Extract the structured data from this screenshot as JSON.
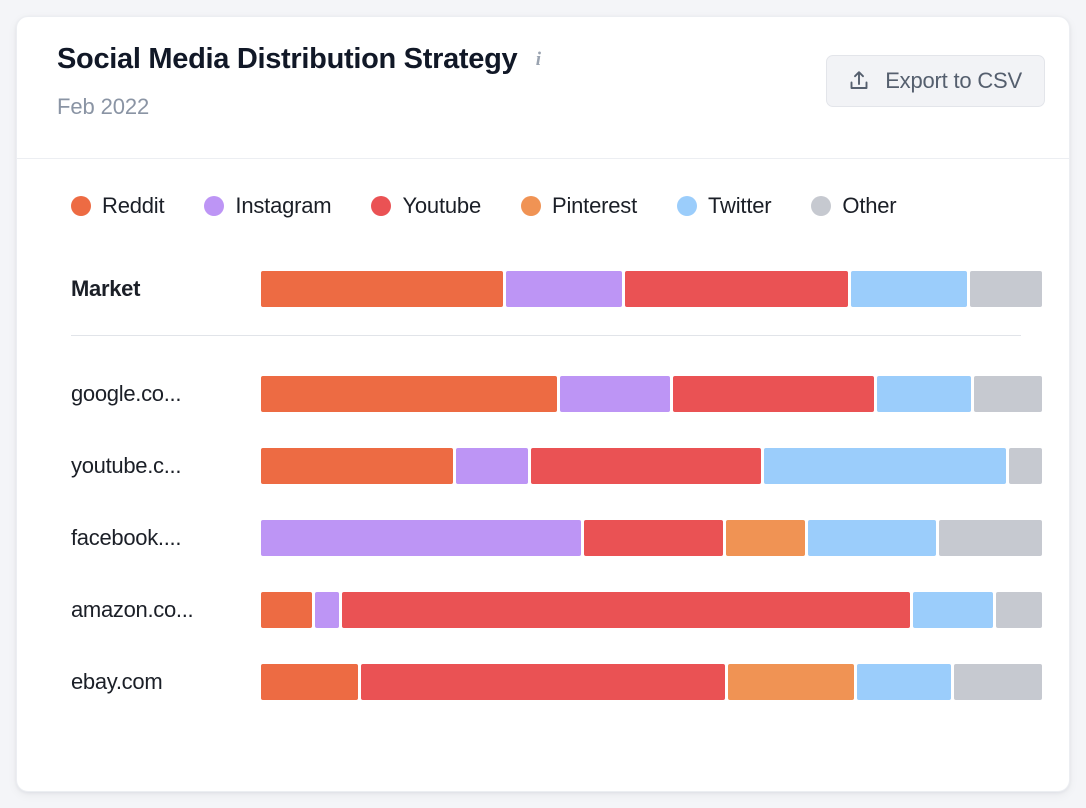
{
  "header": {
    "title": "Social Media Distribution Strategy",
    "info_icon": "info-icon",
    "subtitle": "Feb 2022",
    "export_label": "Export to CSV",
    "export_icon": "upload-icon"
  },
  "colors": {
    "reddit": "#ED6B43",
    "instagram": "#BD95F5",
    "youtube": "#EA5254",
    "pinterest": "#F09354",
    "twitter": "#9BCDFB",
    "other": "#C6C9D0",
    "card_bg": "#FFFFFF",
    "page_bg": "#F4F5F8",
    "text": "#1B1F27",
    "muted": "#8A94A4"
  },
  "legend": [
    {
      "label": "Reddit",
      "color": "#ED6B43",
      "key": "reddit"
    },
    {
      "label": "Instagram",
      "color": "#BD95F5",
      "key": "instagram"
    },
    {
      "label": "Youtube",
      "color": "#EA5254",
      "key": "youtube"
    },
    {
      "label": "Pinterest",
      "color": "#F09354",
      "key": "pinterest"
    },
    {
      "label": "Twitter",
      "color": "#9BCDFB",
      "key": "twitter"
    },
    {
      "label": "Other",
      "color": "#C6C9D0",
      "key": "other"
    }
  ],
  "chart_data": {
    "type": "bar",
    "subtype": "stacked-horizontal-100",
    "title": "Social Media Distribution Strategy",
    "subtitle": "Feb 2022",
    "xlabel": "",
    "ylabel": "",
    "grid": false,
    "legend_position": "top-left",
    "xlim": [
      0,
      100
    ],
    "series": [
      {
        "name": "Reddit",
        "color": "#ED6B43"
      },
      {
        "name": "Instagram",
        "color": "#BD95F5"
      },
      {
        "name": "Youtube",
        "color": "#EA5254"
      },
      {
        "name": "Pinterest",
        "color": "#F09354"
      },
      {
        "name": "Twitter",
        "color": "#9BCDFB"
      },
      {
        "name": "Other",
        "color": "#C6C9D0"
      }
    ],
    "categories": [
      "Market",
      "google.co...",
      "youtube.c...",
      "facebook....",
      "amazon.co...",
      "ebay.com"
    ],
    "rows": [
      {
        "label": "Market",
        "is_summary": true,
        "segments": [
          {
            "name": "Reddit",
            "value": 31.2
          },
          {
            "name": "Instagram",
            "value": 15.2
          },
          {
            "name": "Youtube",
            "value": 28.8
          },
          {
            "name": "Twitter",
            "value": 15.2
          },
          {
            "name": "Other",
            "value": 9.6
          }
        ]
      },
      {
        "label": "google.co...",
        "is_summary": false,
        "segments": [
          {
            "name": "Reddit",
            "value": 38.2
          },
          {
            "name": "Instagram",
            "value": 14.4
          },
          {
            "name": "Youtube",
            "value": 26.0
          },
          {
            "name": "Twitter",
            "value": 12.4
          },
          {
            "name": "Other",
            "value": 9.0
          }
        ]
      },
      {
        "label": "youtube.c...",
        "is_summary": false,
        "segments": [
          {
            "name": "Reddit",
            "value": 24.9
          },
          {
            "name": "Instagram",
            "value": 9.6
          },
          {
            "name": "Youtube",
            "value": 29.7
          },
          {
            "name": "Twitter",
            "value": 31.2
          },
          {
            "name": "Other",
            "value": 4.6
          }
        ]
      },
      {
        "label": "facebook....",
        "is_summary": false,
        "segments": [
          {
            "name": "Instagram",
            "value": 41.2
          },
          {
            "name": "Youtube",
            "value": 18.1
          },
          {
            "name": "Pinterest",
            "value": 10.5
          },
          {
            "name": "Twitter",
            "value": 16.7
          },
          {
            "name": "Other",
            "value": 13.5
          }
        ]
      },
      {
        "label": "amazon.co...",
        "is_summary": false,
        "segments": [
          {
            "name": "Reddit",
            "value": 6.9
          },
          {
            "name": "Instagram",
            "value": 3.4
          },
          {
            "name": "Youtube",
            "value": 72.8
          },
          {
            "name": "Twitter",
            "value": 10.6
          },
          {
            "name": "Other",
            "value": 6.3
          }
        ]
      },
      {
        "label": "ebay.com",
        "is_summary": false,
        "segments": [
          {
            "name": "Reddit",
            "value": 12.7
          },
          {
            "name": "Youtube",
            "value": 46.9
          },
          {
            "name": "Pinterest",
            "value": 16.4
          },
          {
            "name": "Twitter",
            "value": 12.4
          },
          {
            "name": "Other",
            "value": 11.6
          }
        ]
      }
    ]
  }
}
